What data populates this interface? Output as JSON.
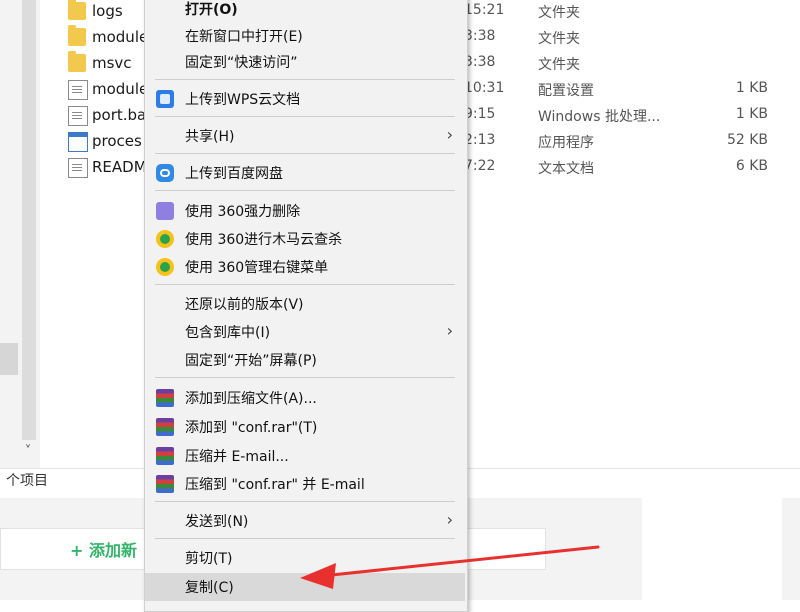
{
  "explorer": {
    "files": [
      {
        "name": "logs",
        "time": "15:21",
        "type": "文件夹",
        "size": "",
        "icon": "folder-icon"
      },
      {
        "name": "module",
        "time": "3:38",
        "type": "文件夹",
        "size": "",
        "icon": "folder-icon"
      },
      {
        "name": "msvc",
        "time": "3:38",
        "type": "文件夹",
        "size": "",
        "icon": "folder-icon"
      },
      {
        "name": "module",
        "time": "10:31",
        "type": "配置设置",
        "size": "1 KB",
        "icon": "config-file-icon"
      },
      {
        "name": "port.ba",
        "time": "9:15",
        "type": "Windows 批处理...",
        "size": "1 KB",
        "icon": "batch-file-icon"
      },
      {
        "name": "proces",
        "time": "2:13",
        "type": "应用程序",
        "size": "52 KB",
        "icon": "exe-file-icon"
      },
      {
        "name": "READM",
        "time": "7:22",
        "type": "文本文档",
        "size": "6 KB",
        "icon": "text-file-icon"
      }
    ],
    "status": "个项目",
    "scroll_down": "˅"
  },
  "web": {
    "add_label": "+ 添加新"
  },
  "menu": {
    "open": "打开(O)",
    "open_new_window": "在新窗口中打开(E)",
    "pin_quick_access": "固定到“快速访问”",
    "upload_wps": "上传到WPS云文档",
    "share": "共享(H)",
    "upload_baidu": "上传到百度网盘",
    "delete_360": "使用 360强力删除",
    "scan_360": "使用 360进行木马云查杀",
    "manage_360": "使用 360管理右键菜单",
    "restore_versions": "还原以前的版本(V)",
    "include_library": "包含到库中(I)",
    "pin_start": "固定到“开始”屏幕(P)",
    "add_archive": "添加到压缩文件(A)...",
    "add_conf_rar": "添加到 \"conf.rar\"(T)",
    "compress_email": "压缩并 E-mail...",
    "compress_conf_email": "压缩到 \"conf.rar\" 并 E-mail",
    "send_to": "发送到(N)",
    "cut": "剪切(T)",
    "copy": "复制(C)",
    "submenu_arrow": "›"
  },
  "colors": {
    "annotation_arrow": "#e8312f",
    "menu_bg": "#f2f2f2",
    "hover_bg": "#d9d9d9",
    "add_green": "#36b36b"
  }
}
